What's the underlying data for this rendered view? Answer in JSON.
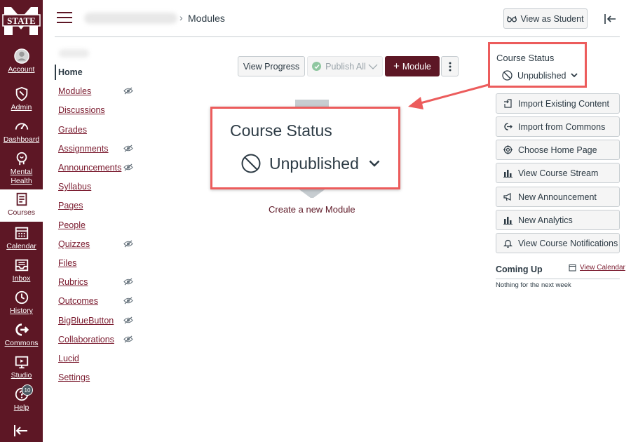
{
  "global_nav": {
    "logo_text": "STATE",
    "items": [
      {
        "label": "Account",
        "icon": "user-avatar-icon"
      },
      {
        "label": "Admin",
        "icon": "shield-icon"
      },
      {
        "label": "Dashboard",
        "icon": "speedometer-icon"
      },
      {
        "label": "Mental Health",
        "icon": "mental-health-icon"
      },
      {
        "label": "Courses",
        "icon": "courses-icon",
        "active": true
      },
      {
        "label": "Calendar",
        "icon": "calendar-icon"
      },
      {
        "label": "Inbox",
        "icon": "inbox-icon"
      },
      {
        "label": "History",
        "icon": "clock-icon"
      },
      {
        "label": "Commons",
        "icon": "commons-icon"
      },
      {
        "label": "Studio",
        "icon": "studio-icon"
      },
      {
        "label": "Help",
        "icon": "help-icon",
        "badge": "10"
      }
    ]
  },
  "header": {
    "breadcrumb_current": "Modules",
    "view_as_student": "View as Student"
  },
  "course_nav": [
    {
      "label": "Home",
      "active": true,
      "hidden": false
    },
    {
      "label": "Modules",
      "hidden": true
    },
    {
      "label": "Discussions",
      "hidden": false
    },
    {
      "label": "Grades",
      "hidden": false
    },
    {
      "label": "Assignments",
      "hidden": true
    },
    {
      "label": "Announcements",
      "hidden": true
    },
    {
      "label": "Syllabus",
      "hidden": false
    },
    {
      "label": "Pages",
      "hidden": false
    },
    {
      "label": "People",
      "hidden": false
    },
    {
      "label": "Quizzes",
      "hidden": true
    },
    {
      "label": "Files",
      "hidden": false
    },
    {
      "label": "Rubrics",
      "hidden": true
    },
    {
      "label": "Outcomes",
      "hidden": true
    },
    {
      "label": "BigBlueButton",
      "hidden": true
    },
    {
      "label": "Collaborations",
      "hidden": true
    },
    {
      "label": "Lucid",
      "hidden": false
    },
    {
      "label": "Settings",
      "hidden": false
    }
  ],
  "toolbar": {
    "view_progress": "View Progress",
    "publish_all": "Publish All",
    "add_module": "Module"
  },
  "main": {
    "create_module": "Create a new Module"
  },
  "callout": {
    "title": "Course Status",
    "status": "Unpublished"
  },
  "sidebar": {
    "course_status_title": "Course Status",
    "course_status_value": "Unpublished",
    "buttons": [
      {
        "label": "Import Existing Content",
        "icon": "import-icon"
      },
      {
        "label": "Import from Commons",
        "icon": "commons-icon"
      },
      {
        "label": "Choose Home Page",
        "icon": "target-icon"
      },
      {
        "label": "View Course Stream",
        "icon": "bar-chart-icon"
      },
      {
        "label": "New Announcement",
        "icon": "megaphone-icon"
      },
      {
        "label": "New Analytics",
        "icon": "bar-chart-icon"
      },
      {
        "label": "View Course Notifications",
        "icon": "bell-icon"
      }
    ],
    "coming_up": "Coming Up",
    "view_calendar": "View Calendar",
    "nothing_next_week": "Nothing for the next week"
  },
  "colors": {
    "brand": "#5d1725",
    "callout_border": "#ec5c5c"
  }
}
